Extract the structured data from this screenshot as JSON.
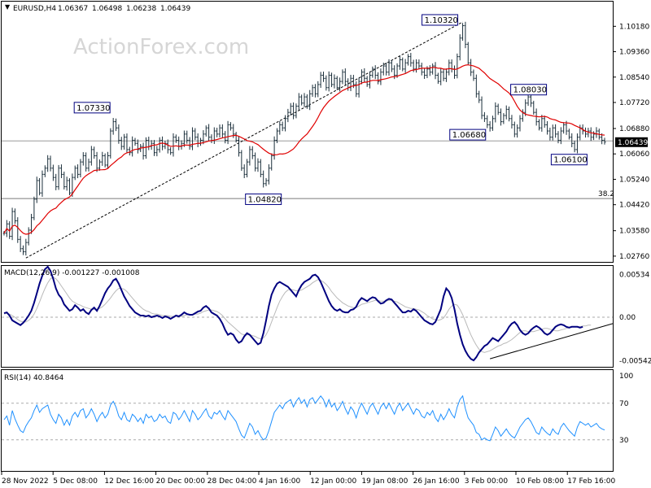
{
  "chart_data": [
    {
      "type": "candlestick",
      "title": "EURUSD,H4",
      "quote": {
        "open": "1.06367",
        "high": "1.06498",
        "low": "1.06238",
        "close": "1.06439"
      },
      "watermark": "ActionForex.com",
      "ylim": [
        1.026,
        1.1095
      ],
      "y_ticks": [
        "1.10180",
        "1.09360",
        "1.08540",
        "1.07720",
        "1.06880",
        "1.06060",
        "1.05240",
        "1.04420",
        "1.03580",
        "1.02760"
      ],
      "current_price": "1.06439",
      "moving_average_color": "#e00000",
      "bar_color": "#1b2f3b",
      "annotations": [
        {
          "text": "1.07330",
          "bar": 40,
          "price": 1.0733
        },
        {
          "text": "1.04820",
          "bar": 95,
          "price": 1.0482
        },
        {
          "text": "1.10320",
          "bar": 168,
          "price": 1.1032
        },
        {
          "text": "1.06680",
          "bar": 177,
          "price": 1.0668
        },
        {
          "text": "1.08030",
          "bar": 185,
          "price": 1.0803
        },
        {
          "text": "1.06100",
          "bar": 207,
          "price": 1.061
        }
      ],
      "fib_label": "38.2",
      "fib_level": 1.0462,
      "hline": 1.0648,
      "trendline": {
        "from": {
          "bar": 8,
          "price": 1.027
        },
        "to": {
          "bar": 168,
          "price": 1.1032
        }
      },
      "x_ticks": [
        "28 Nov 2022",
        "5 Dec 08:00",
        "12 Dec 16:00",
        "20 Dec 00:00",
        "28 Dec 04:00",
        "4 Jan 16:00",
        "12 Jan 00:00",
        "19 Jan 08:00",
        "26 Jan 16:00",
        "3 Feb 00:00",
        "10 Feb 08:00",
        "17 Feb 16:00"
      ],
      "closes": [
        1.035,
        1.038,
        1.034,
        1.042,
        1.039,
        1.033,
        1.03,
        1.029,
        1.032,
        1.036,
        1.04,
        1.046,
        1.052,
        1.048,
        1.054,
        1.056,
        1.059,
        1.056,
        1.053,
        1.05,
        1.056,
        1.054,
        1.05,
        1.052,
        1.048,
        1.053,
        1.056,
        1.054,
        1.058,
        1.06,
        1.056,
        1.058,
        1.062,
        1.06,
        1.056,
        1.058,
        1.06,
        1.057,
        1.06,
        1.068,
        1.071,
        1.069,
        1.065,
        1.063,
        1.066,
        1.062,
        1.061,
        1.065,
        1.064,
        1.062,
        1.063,
        1.06,
        1.065,
        1.063,
        1.064,
        1.061,
        1.062,
        1.065,
        1.063,
        1.064,
        1.062,
        1.061,
        1.066,
        1.065,
        1.063,
        1.064,
        1.067,
        1.065,
        1.063,
        1.068,
        1.066,
        1.064,
        1.065,
        1.067,
        1.069,
        1.066,
        1.065,
        1.068,
        1.067,
        1.069,
        1.067,
        1.065,
        1.07,
        1.069,
        1.067,
        1.065,
        1.061,
        1.056,
        1.054,
        1.058,
        1.062,
        1.06,
        1.056,
        1.058,
        1.054,
        1.051,
        1.052,
        1.056,
        1.06,
        1.065,
        1.068,
        1.07,
        1.069,
        1.072,
        1.074,
        1.076,
        1.073,
        1.076,
        1.079,
        1.077,
        1.079,
        1.076,
        1.08,
        1.082,
        1.08,
        1.083,
        1.086,
        1.085,
        1.082,
        1.086,
        1.083,
        1.085,
        1.082,
        1.084,
        1.087,
        1.084,
        1.082,
        1.085,
        1.083,
        1.08,
        1.084,
        1.087,
        1.085,
        1.083,
        1.086,
        1.088,
        1.086,
        1.084,
        1.087,
        1.089,
        1.087,
        1.09,
        1.088,
        1.086,
        1.089,
        1.091,
        1.088,
        1.09,
        1.092,
        1.09,
        1.088,
        1.09,
        1.089,
        1.087,
        1.086,
        1.088,
        1.087,
        1.089,
        1.086,
        1.084,
        1.087,
        1.085,
        1.087,
        1.09,
        1.088,
        1.086,
        1.092,
        1.098,
        1.102,
        1.096,
        1.09,
        1.087,
        1.085,
        1.08,
        1.078,
        1.073,
        1.072,
        1.07,
        1.069,
        1.072,
        1.076,
        1.074,
        1.071,
        1.073,
        1.075,
        1.072,
        1.07,
        1.067,
        1.069,
        1.072,
        1.074,
        1.077,
        1.079,
        1.077,
        1.074,
        1.071,
        1.069,
        1.072,
        1.07,
        1.068,
        1.066,
        1.069,
        1.067,
        1.065,
        1.068,
        1.07,
        1.068,
        1.066,
        1.064,
        1.062,
        1.066,
        1.069,
        1.068,
        1.067,
        1.068,
        1.066,
        1.067,
        1.068,
        1.066,
        1.065,
        1.0644
      ]
    },
    {
      "type": "line",
      "title": "MACD(12,26,9) -0.001227 -0.001008",
      "ylim": [
        -0.0062,
        0.0063
      ],
      "y_ticks": [
        "0.00534",
        "0.00",
        "-0.005421"
      ],
      "zero_label": "0.00",
      "series": [
        {
          "values": [
            0.0005,
            0.0006,
            0.0002,
            -0.0004,
            -0.0006,
            -0.0008,
            -0.001,
            -0.0007,
            -0.0003,
            0.0002,
            0.0008,
            0.0018,
            0.003,
            0.0042,
            0.0052,
            0.006,
            0.0063,
            0.0058,
            0.0048,
            0.0036,
            0.0028,
            0.0024,
            0.0016,
            0.0012,
            0.0008,
            0.001,
            0.0015,
            0.0012,
            0.0008,
            0.001,
            0.0006,
            0.0004,
            0.0009,
            0.0012,
            0.0008,
            0.0014,
            0.0022,
            0.003,
            0.0036,
            0.004,
            0.0046,
            0.0048,
            0.0042,
            0.0034,
            0.0026,
            0.002,
            0.0014,
            0.001,
            0.0006,
            0.0004,
            0.0002,
            0.0002,
            0.0001,
            0.0002,
            0.0,
            0.0001,
            0.0002,
            0.0001,
            -0.0001,
            0.0001,
            0.0,
            -0.0002,
            0.0,
            0.0002,
            0.0001,
            0.0003,
            0.0006,
            0.0004,
            0.0003,
            0.0003,
            0.0005,
            0.0007,
            0.0008,
            0.0012,
            0.0014,
            0.0011,
            0.0006,
            0.0004,
            0.0002,
            -0.0002,
            -0.0008,
            -0.0016,
            -0.0022,
            -0.002,
            -0.0022,
            -0.0028,
            -0.0032,
            -0.003,
            -0.0024,
            -0.002,
            -0.0022,
            -0.0026,
            -0.003,
            -0.0034,
            -0.0032,
            -0.002,
            -0.0004,
            0.0014,
            0.0028,
            0.0036,
            0.0042,
            0.0044,
            0.0042,
            0.004,
            0.0038,
            0.0034,
            0.003,
            0.0026,
            0.0034,
            0.004,
            0.0044,
            0.0046,
            0.0048,
            0.0052,
            0.0053,
            0.005,
            0.0044,
            0.0036,
            0.0028,
            0.002,
            0.0014,
            0.001,
            0.0008,
            0.001,
            0.0007,
            0.0006,
            0.0006,
            0.0009,
            0.001,
            0.0013,
            0.002,
            0.0024,
            0.0022,
            0.002,
            0.0023,
            0.0025,
            0.0024,
            0.002,
            0.0017,
            0.0018,
            0.0021,
            0.0023,
            0.0022,
            0.0018,
            0.0014,
            0.001,
            0.0006,
            0.0006,
            0.0008,
            0.0007,
            0.001,
            0.0008,
            0.0004,
            0.0,
            -0.0004,
            -0.0006,
            -0.0008,
            -0.0009,
            -0.0006,
            0.0002,
            0.001,
            0.0026,
            0.0036,
            0.0032,
            0.0024,
            0.001,
            -0.0008,
            -0.0022,
            -0.0034,
            -0.0042,
            -0.0048,
            -0.0052,
            -0.0054,
            -0.005,
            -0.0044,
            -0.004,
            -0.0036,
            -0.0034,
            -0.003,
            -0.0026,
            -0.0028,
            -0.003,
            -0.0026,
            -0.0022,
            -0.0018,
            -0.0012,
            -0.0008,
            -0.0006,
            -0.001,
            -0.0016,
            -0.002,
            -0.0022,
            -0.002,
            -0.0016,
            -0.0013,
            -0.0011,
            -0.0013,
            -0.0016,
            -0.002,
            -0.0022,
            -0.002,
            -0.0016,
            -0.0012,
            -0.001,
            -0.0009,
            -0.001,
            -0.0012,
            -0.0013,
            -0.0012,
            -0.0012,
            -0.0012,
            -0.0013,
            -0.0012
          ]
        },
        {
          "values": [
            0.0004,
            0.0005,
            0.0004,
            0.0002,
            0.0,
            -0.0003,
            -0.0005,
            -0.0006,
            -0.0006,
            -0.0004,
            -0.0001,
            0.0004,
            0.0011,
            0.0019,
            0.0028,
            0.0036,
            0.0043,
            0.0048,
            0.005,
            0.0048,
            0.0044,
            0.0039,
            0.0034,
            0.0029,
            0.0024,
            0.002,
            0.0018,
            0.0016,
            0.0015,
            0.0013,
            0.0012,
            0.0011,
            0.001,
            0.001,
            0.001,
            0.0011,
            0.0013,
            0.0016,
            0.002,
            0.0024,
            0.0029,
            0.0033,
            0.0036,
            0.0036,
            0.0035,
            0.0032,
            0.0028,
            0.0024,
            0.002,
            0.0016,
            0.0013,
            0.001,
            0.0008,
            0.0007,
            0.0005,
            0.0004,
            0.0004,
            0.0003,
            0.0002,
            0.0002,
            0.0002,
            0.0001,
            0.0001,
            0.0001,
            0.0001,
            0.0001,
            0.0002,
            0.0003,
            0.0003,
            0.0003,
            0.0004,
            0.0004,
            0.0005,
            0.0007,
            0.0008,
            0.0009,
            0.0009,
            0.0008,
            0.0007,
            0.0005,
            0.0002,
            -0.0002,
            -0.0006,
            -0.0009,
            -0.0012,
            -0.0015,
            -0.0018,
            -0.0021,
            -0.0022,
            -0.0022,
            -0.0022,
            -0.0023,
            -0.0024,
            -0.0026,
            -0.0027,
            -0.0026,
            -0.0022,
            -0.0015,
            -0.0006,
            0.0003,
            0.0012,
            0.002,
            0.0026,
            0.0031,
            0.0034,
            0.0035,
            0.0034,
            0.0033,
            0.0033,
            0.0034,
            0.0036,
            0.0038,
            0.004,
            0.0043,
            0.0045,
            0.0047,
            0.0046,
            0.0044,
            0.0041,
            0.0037,
            0.0032,
            0.0028,
            0.0024,
            0.0021,
            0.0018,
            0.0016,
            0.0014,
            0.0013,
            0.0012,
            0.0012,
            0.0014,
            0.0016,
            0.0017,
            0.0018,
            0.0019,
            0.002,
            0.0021,
            0.0021,
            0.002,
            0.002,
            0.002,
            0.0021,
            0.0021,
            0.002,
            0.0019,
            0.0017,
            0.0015,
            0.0013,
            0.0012,
            0.0011,
            0.0011,
            0.001,
            0.0009,
            0.0007,
            0.0005,
            0.0002,
            0.0,
            -0.0002,
            -0.0003,
            -0.0004,
            -0.0003,
            -0.0001,
            0.0004,
            0.001,
            0.0014,
            0.0016,
            0.0015,
            0.001,
            0.0003,
            -0.0005,
            -0.0014,
            -0.0022,
            -0.0029,
            -0.0035,
            -0.004,
            -0.0043,
            -0.0044,
            -0.0043,
            -0.0042,
            -0.004,
            -0.0038,
            -0.0036,
            -0.0035,
            -0.0033,
            -0.0032,
            -0.003,
            -0.0028,
            -0.0025,
            -0.0022,
            -0.0019,
            -0.0017,
            -0.0017,
            -0.0018,
            -0.0018,
            -0.0018,
            -0.0017,
            -0.0016,
            -0.0015,
            -0.0014,
            -0.0014,
            -0.0015,
            -0.0016,
            -0.0017,
            -0.0017,
            -0.0016,
            -0.0015,
            -0.0014,
            -0.0013,
            -0.0012,
            -0.0012,
            -0.0012,
            -0.0012,
            -0.0011,
            -0.0011,
            -0.001,
            -0.001
          ]
        }
      ],
      "trendline": {
        "from": {
          "bar": 178,
          "value": -0.0052
        },
        "to": {
          "bar": 219,
          "value": -0.0014
        }
      }
    },
    {
      "type": "line",
      "title": "RSI(14) 40.8464",
      "ylim": [
        0,
        100
      ],
      "y_ticks": [
        "100",
        "70",
        "30"
      ],
      "levels": [
        70,
        30
      ],
      "values": [
        52,
        56,
        46,
        62,
        53,
        46,
        40,
        38,
        45,
        50,
        54,
        62,
        68,
        60,
        64,
        66,
        68,
        58,
        52,
        48,
        58,
        54,
        46,
        52,
        46,
        56,
        60,
        55,
        62,
        64,
        54,
        58,
        64,
        58,
        50,
        56,
        60,
        54,
        58,
        68,
        72,
        66,
        56,
        52,
        60,
        52,
        50,
        58,
        55,
        50,
        54,
        48,
        58,
        54,
        56,
        50,
        52,
        58,
        54,
        56,
        50,
        48,
        60,
        58,
        52,
        56,
        62,
        56,
        50,
        62,
        58,
        52,
        55,
        60,
        64,
        56,
        53,
        60,
        58,
        62,
        56,
        52,
        62,
        58,
        54,
        50,
        42,
        35,
        32,
        40,
        48,
        44,
        36,
        40,
        34,
        30,
        32,
        40,
        50,
        60,
        64,
        68,
        64,
        70,
        72,
        74,
        66,
        72,
        76,
        70,
        74,
        66,
        74,
        76,
        70,
        74,
        78,
        74,
        66,
        74,
        66,
        70,
        62,
        66,
        72,
        64,
        58,
        66,
        62,
        54,
        64,
        70,
        64,
        58,
        66,
        70,
        64,
        58,
        66,
        70,
        64,
        70,
        64,
        58,
        66,
        70,
        62,
        66,
        70,
        64,
        58,
        64,
        62,
        56,
        54,
        60,
        57,
        62,
        54,
        50,
        58,
        52,
        57,
        64,
        58,
        54,
        66,
        74,
        78,
        64,
        54,
        50,
        46,
        38,
        36,
        30,
        32,
        30,
        29,
        36,
        44,
        40,
        34,
        38,
        42,
        37,
        34,
        32,
        38,
        44,
        48,
        52,
        54,
        50,
        44,
        38,
        36,
        44,
        40,
        37,
        35,
        42,
        38,
        36,
        44,
        48,
        44,
        40,
        37,
        34,
        44,
        50,
        48,
        46,
        48,
        44,
        46,
        48,
        44,
        42,
        40.8
      ]
    }
  ]
}
